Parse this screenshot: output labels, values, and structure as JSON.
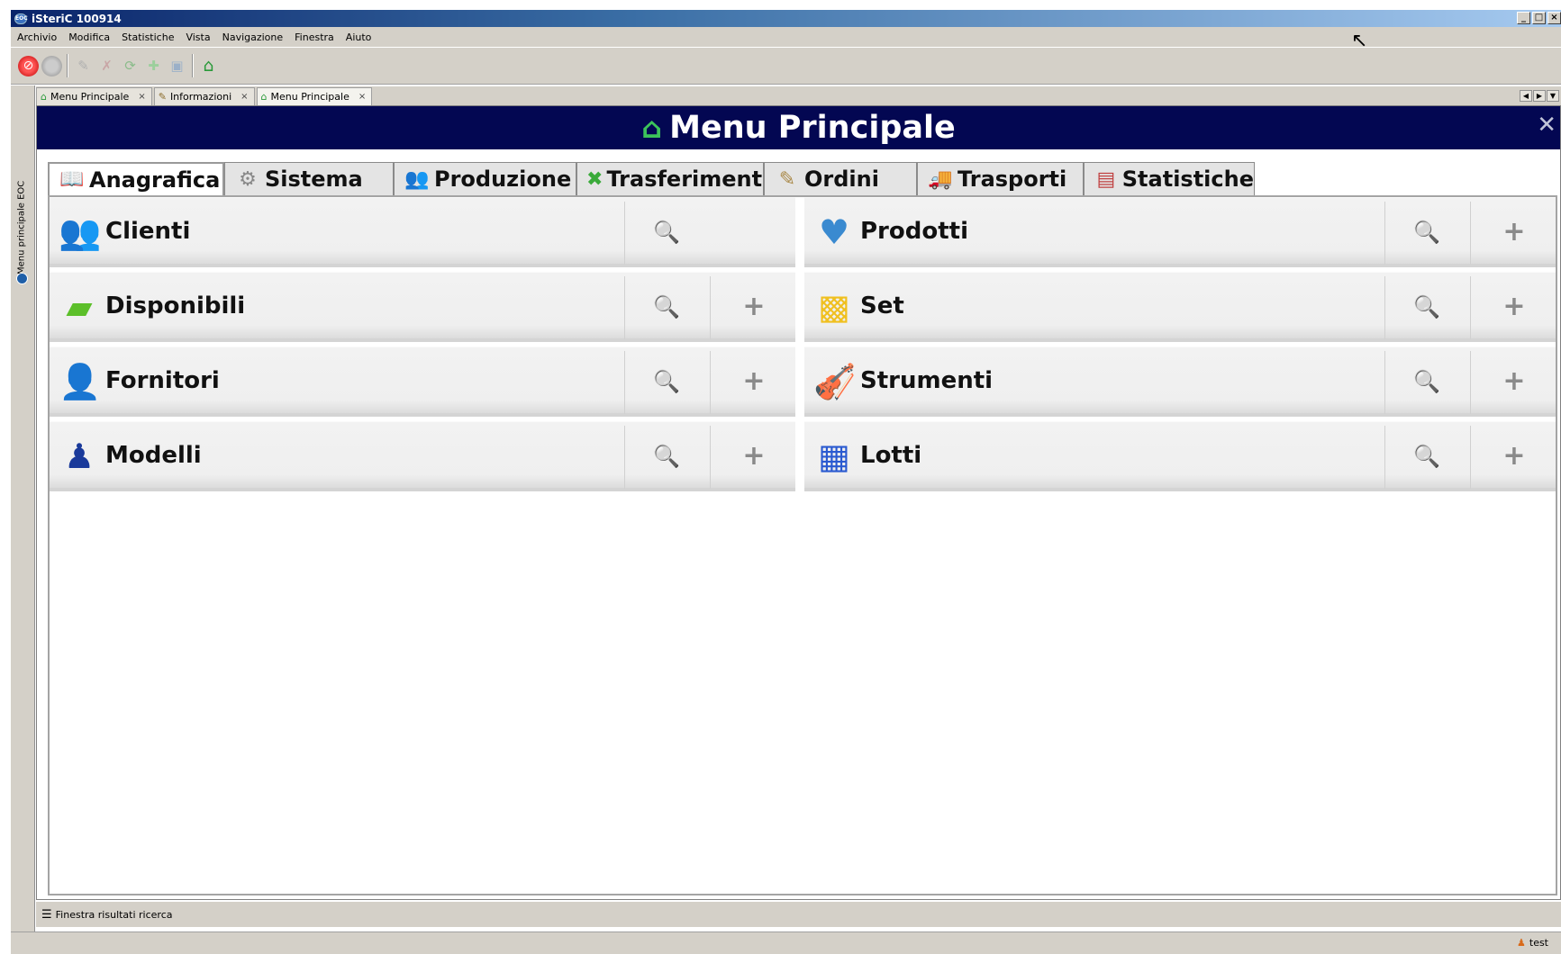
{
  "window": {
    "title": "iSteriC 100914",
    "app_icon": "EOC"
  },
  "menu": [
    "Archivio",
    "Modifica",
    "Statistiche",
    "Vista",
    "Navigazione",
    "Finestra",
    "Aiuto"
  ],
  "toolbar": {
    "icons": [
      "stop-icon",
      "circle-icon",
      "pencil-icon",
      "delete-icon",
      "refresh-icon",
      "add-icon",
      "save-icon",
      "home-icon"
    ]
  },
  "side_panel": {
    "label": "Menu principale EOC"
  },
  "doc_tabs": [
    {
      "label": "Menu Principale",
      "icon": "home-icon",
      "close": "×"
    },
    {
      "label": "Informazioni",
      "icon": "edit-icon",
      "close": "×"
    },
    {
      "label": "Menu Principale",
      "icon": "home-icon",
      "close": "×",
      "active": true
    }
  ],
  "header": {
    "title": "Menu Principale",
    "close": "✕"
  },
  "section_tabs": [
    {
      "label": "Anagrafica",
      "icon": "book-icon",
      "active": true
    },
    {
      "label": "Sistema",
      "icon": "gear-icon"
    },
    {
      "label": "Produzione",
      "icon": "people-icon"
    },
    {
      "label": "Trasferimenti",
      "icon": "transfer-icon"
    },
    {
      "label": "Ordini",
      "icon": "clipboard-icon"
    },
    {
      "label": "Trasporti",
      "icon": "truck-icon"
    },
    {
      "label": "Statistiche",
      "icon": "chart-icon"
    }
  ],
  "items_left": [
    {
      "label": "Clienti",
      "icon": "clients-icon",
      "search": true,
      "add": false
    },
    {
      "label": "Disponibili",
      "icon": "flag-icon",
      "search": true,
      "add": true
    },
    {
      "label": "Fornitori",
      "icon": "supplier-icon",
      "search": true,
      "add": true
    },
    {
      "label": "Modelli",
      "icon": "stamp-icon",
      "search": true,
      "add": true
    }
  ],
  "items_right": [
    {
      "label": "Prodotti",
      "icon": "heart-icon",
      "search": true,
      "add": true
    },
    {
      "label": "Set",
      "icon": "brick-icon",
      "search": true,
      "add": true
    },
    {
      "label": "Strumenti",
      "icon": "violin-icon",
      "search": true,
      "add": true
    },
    {
      "label": "Lotti",
      "icon": "calendar-icon",
      "search": true,
      "add": true
    }
  ],
  "search_glyph": "🔍",
  "add_glyph": "+",
  "status": {
    "label": "Finestra risultati ricerca",
    "user": "test"
  }
}
